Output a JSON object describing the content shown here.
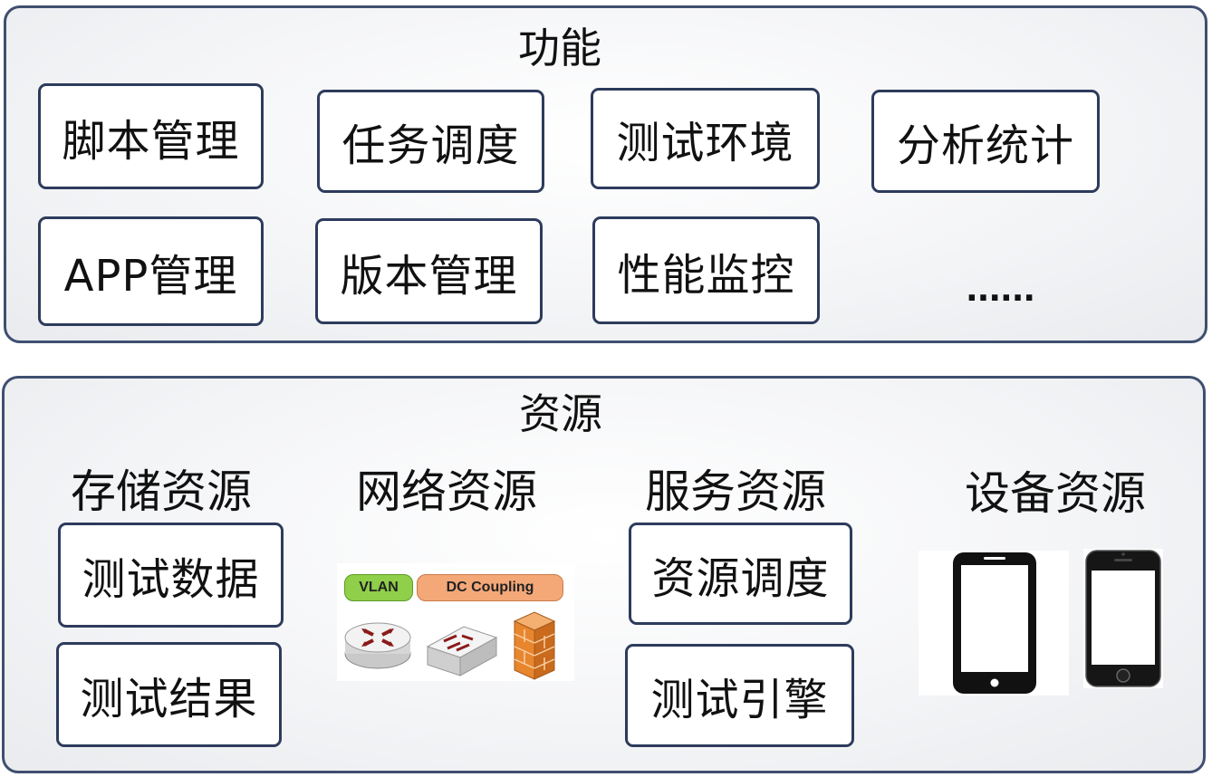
{
  "functions": {
    "title": "功能",
    "items": [
      {
        "label": "脚本管理"
      },
      {
        "label": "任务调度"
      },
      {
        "label": "测试环境"
      },
      {
        "label": "分析统计"
      },
      {
        "label": "APP管理"
      },
      {
        "label": "版本管理"
      },
      {
        "label": "性能监控"
      }
    ],
    "ellipsis": "......"
  },
  "resources": {
    "title": "资源",
    "categories": [
      {
        "label": "存储资源",
        "items": [
          {
            "label": "测试数据"
          },
          {
            "label": "测试结果"
          }
        ]
      },
      {
        "label": "网络资源",
        "tags": [
          "VLAN",
          "DC Coupling"
        ]
      },
      {
        "label": "服务资源",
        "items": [
          {
            "label": "资源调度"
          },
          {
            "label": "测试引擎"
          }
        ]
      },
      {
        "label": "设备资源"
      }
    ]
  },
  "colors": {
    "panel_border": "#3f4f70",
    "box_border": "#2d3b5c",
    "vlan_tag": "#8fcf4a",
    "dc_tag": "#f4a878",
    "firewall": "#e8862e"
  },
  "icons": [
    "router-icon",
    "switch-icon",
    "firewall-icon",
    "smartphone-outline-icon",
    "iphone-icon"
  ]
}
